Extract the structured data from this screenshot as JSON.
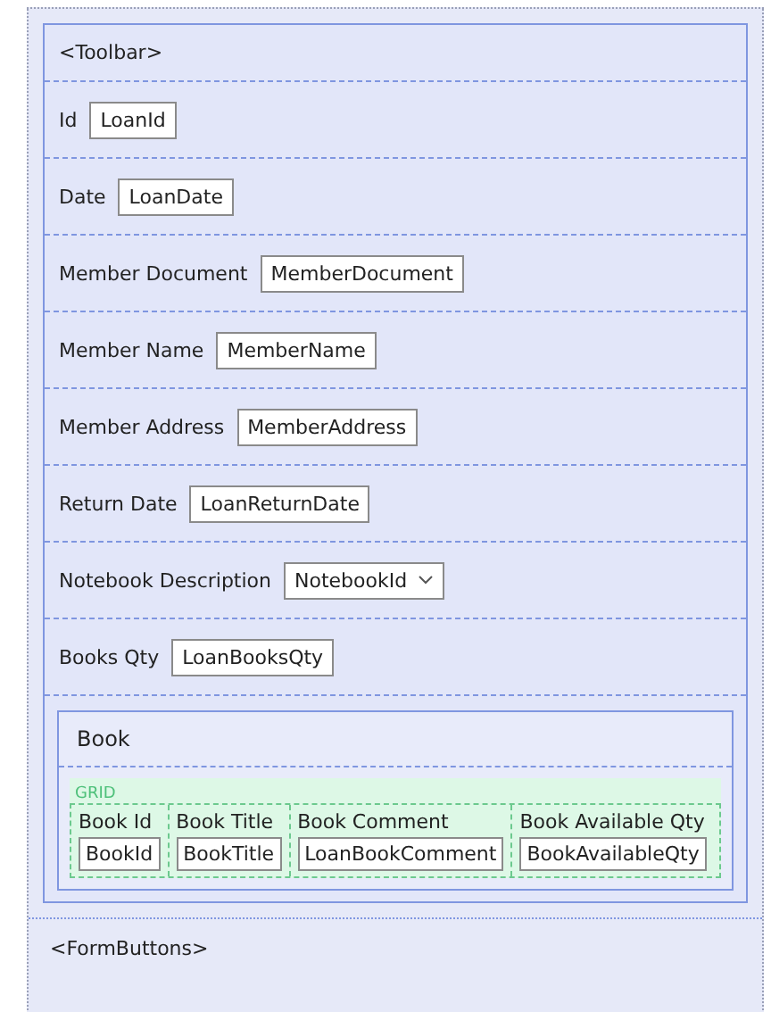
{
  "toolbar": {
    "label": "<Toolbar>"
  },
  "rows": [
    {
      "label": "Id",
      "kind": "input",
      "value": "LoanId"
    },
    {
      "label": "Date",
      "kind": "input",
      "value": "LoanDate"
    },
    {
      "label": "Member Document",
      "kind": "input",
      "value": "MemberDocument"
    },
    {
      "label": "Member Name",
      "kind": "input",
      "value": "MemberName"
    },
    {
      "label": "Member Address",
      "kind": "input",
      "value": "MemberAddress"
    },
    {
      "label": "Return Date",
      "kind": "input",
      "value": "LoanReturnDate"
    },
    {
      "label": "Notebook Description",
      "kind": "dropdown",
      "value": "NotebookId"
    },
    {
      "label": "Books Qty",
      "kind": "input",
      "value": "LoanBooksQty"
    }
  ],
  "group": {
    "title": "Book",
    "grid_label": "GRID",
    "columns": [
      {
        "header": "Book Id",
        "value": "BookId"
      },
      {
        "header": "Book Title",
        "value": "BookTitle"
      },
      {
        "header": "Book Comment",
        "value": "LoanBookComment"
      },
      {
        "header": "Book Available Qty",
        "value": "BookAvailableQty"
      }
    ]
  },
  "form_buttons": {
    "label": "<FormButtons>"
  }
}
